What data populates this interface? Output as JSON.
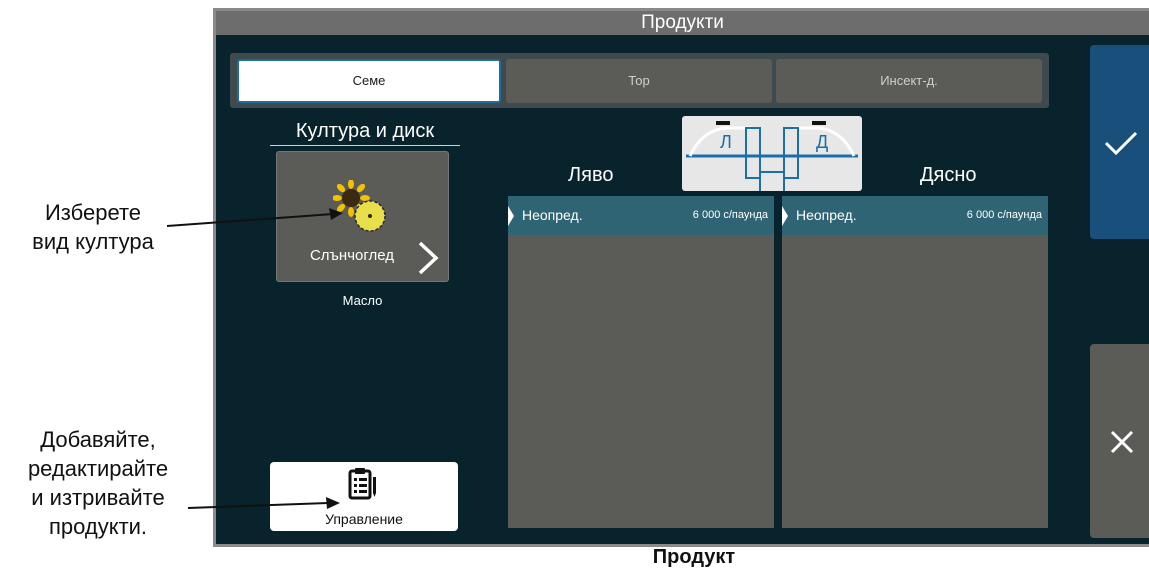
{
  "callouts": {
    "select_crop": [
      "Изберете",
      "вид култура"
    ],
    "manage_products": [
      "Добавяйте,",
      "редактирайте",
      "и изтривайте",
      "продукти."
    ]
  },
  "caption": "Продукт",
  "screen": {
    "title": "Продукти",
    "tabs": [
      {
        "label": "Семе",
        "active": true
      },
      {
        "label": "Тор",
        "active": false
      },
      {
        "label": "Инсект-д.",
        "active": false
      }
    ],
    "crop": {
      "heading": "Култура и диск",
      "name": "Слънчоглед",
      "disk": "Масло",
      "icon": "sunflower-icon"
    },
    "manage_label": "Управление",
    "diagram": {
      "left_letter": "Л",
      "right_letter": "Д"
    },
    "left": {
      "heading": "Ляво",
      "product": "Неопред.",
      "rate": "6 000 с/паунда"
    },
    "right": {
      "heading": "Дясно",
      "product": "Неопред.",
      "rate": "6 000 с/паунда"
    },
    "accept_icon": "checkmark-icon",
    "cancel_icon": "close-icon"
  },
  "colors": {
    "background": "#08232b",
    "panel": "#5b5b58",
    "row_highlight": "#2f6474",
    "accept": "#18507b",
    "active_tab_border": "#1c6e9e"
  }
}
